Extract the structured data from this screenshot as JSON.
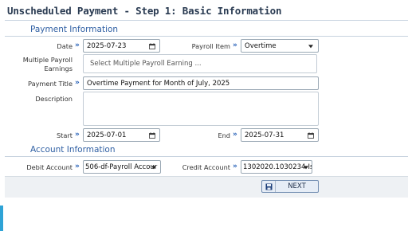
{
  "page": {
    "title": "Unscheduled Payment - Step 1: Basic Information"
  },
  "payment_section": {
    "heading": "Payment Information",
    "date": {
      "label": "Date",
      "value": "2025-07-23"
    },
    "payroll_item": {
      "label": "Payroll Item",
      "value": "Overtime"
    },
    "multiple_payroll": {
      "label": "Multiple Payroll Earnings",
      "placeholder": "Select Multiple Payroll Earning ..."
    },
    "payment_title": {
      "label": "Payment Title",
      "value": "Overtime Payment for Month of July, 2025"
    },
    "description": {
      "label": "Description",
      "value": ""
    },
    "start": {
      "label": "Start",
      "value": "2025-07-01"
    },
    "end": {
      "label": "End",
      "value": "2025-07-31"
    }
  },
  "account_section": {
    "heading": "Account Information",
    "debit_account": {
      "label": "Debit Account",
      "value": "506-df-Payroll Accour"
    },
    "credit_account": {
      "label": "Credit Account",
      "value": "1302020.1030234-Isl"
    }
  },
  "footer": {
    "next_label": "NEXT",
    "save_icon": "save-icon"
  },
  "icons": {
    "arrow": "»",
    "calendar": "calendar-icon",
    "dropdown": "chevron-down-icon"
  },
  "colors": {
    "title": "#2a3b52",
    "section": "#2f5fa3",
    "arrow": "#1e5ab4",
    "accent": "#2ea3d6"
  }
}
